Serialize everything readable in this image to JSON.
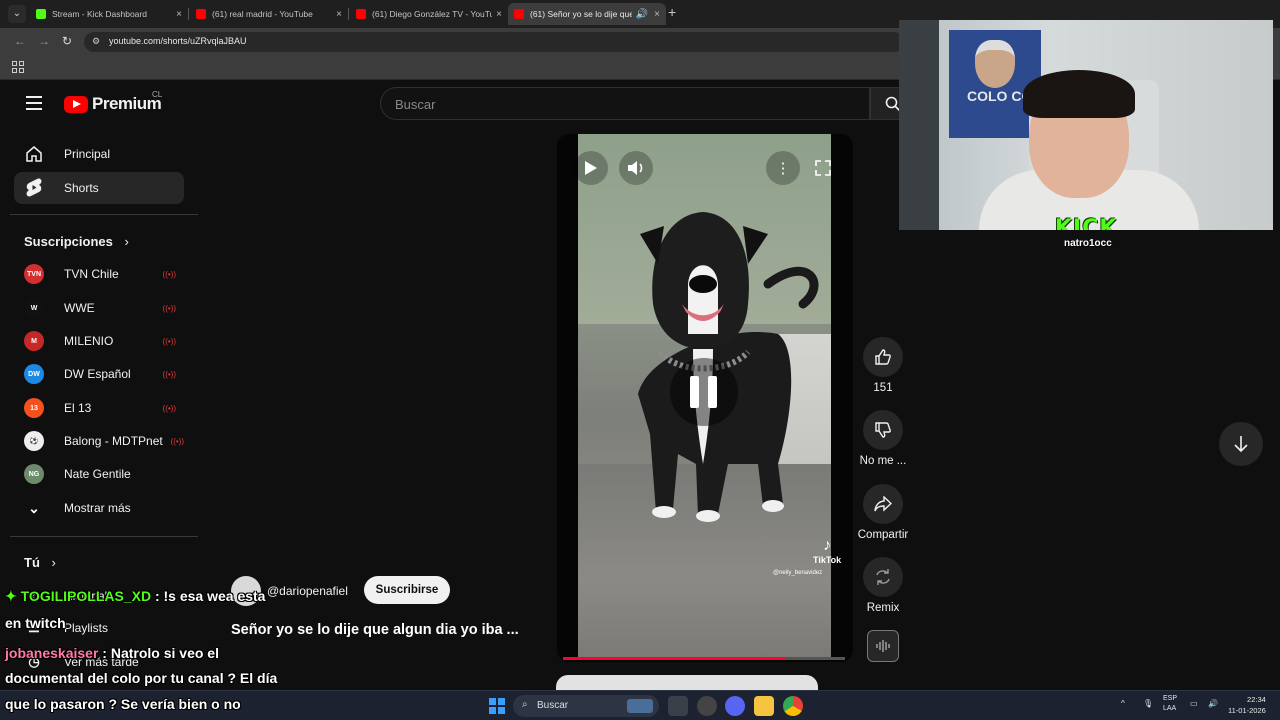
{
  "browser": {
    "tabs": [
      {
        "title": "Stream - Kick Dashboard",
        "favicon_color": "#53fc18",
        "active": false
      },
      {
        "title": "(61) real madrid - YouTube",
        "favicon_color": "#ff0000",
        "active": false
      },
      {
        "title": "(61) Diego González TV - YouTu",
        "favicon_color": "#ff0000",
        "active": false
      },
      {
        "title": "(61) Señor yo se lo dije que",
        "favicon_color": "#ff0000",
        "active": true
      }
    ],
    "url": "youtube.com/shorts/uZRvqlaJBAU"
  },
  "youtube": {
    "logo_text": "Premium",
    "country_code": "CL",
    "search_placeholder": "Buscar",
    "sidebar": {
      "main_items": [
        {
          "label": "Principal",
          "icon": "home-icon"
        },
        {
          "label": "Shorts",
          "icon": "shorts-icon"
        }
      ],
      "subscriptions_heading": "Suscripciones",
      "subscriptions": [
        {
          "name": "TVN Chile",
          "avatar_text": "TVN",
          "color": "#d32f2f",
          "live": true
        },
        {
          "name": "WWE",
          "avatar_text": "W",
          "color": "#111111",
          "live": true
        },
        {
          "name": "MILENIO",
          "avatar_text": "M",
          "color": "#c62828",
          "live": true
        },
        {
          "name": "DW Español",
          "avatar_text": "DW",
          "color": "#1e88e5",
          "live": true
        },
        {
          "name": "El 13",
          "avatar_text": "13",
          "color": "#f4511e",
          "live": true
        },
        {
          "name": "Balong - MDTPnet",
          "avatar_text": "⚽",
          "color": "#eeeeee",
          "live": true
        },
        {
          "name": "Nate Gentile",
          "avatar_text": "NG",
          "color": "#6d8a6a",
          "live": false
        }
      ],
      "show_more": "Mostrar más",
      "you_heading": "Tú",
      "you_items": [
        {
          "label": "Historial"
        },
        {
          "label": "Playlists"
        },
        {
          "label": "Ver más tarde"
        }
      ]
    },
    "short": {
      "channel": "@dariopenafiel",
      "subscribe_label": "Suscribirse",
      "title": "Señor yo se lo dije que algun dia yo iba ...",
      "watermark_brand": "TikTok",
      "watermark_handle": "@neily_benavidez",
      "progress": 0.79
    },
    "actions": {
      "like_count": "151",
      "dislike_label": "No me ...",
      "share_label": "Compartir",
      "remix_label": "Remix"
    }
  },
  "stream_overlay": {
    "webcam_poster_text": "COLO CO",
    "kick_logo": "KICK",
    "kick_user": "natro1occ",
    "chat": [
      {
        "user": "TOGILIPOLLAS_XD",
        "message": ": !s esa wea esta",
        "continuation": "en twitch"
      },
      {
        "user": "jobaneskaiser",
        "message": ": Natrolo si veo el",
        "continuation": "documental del colo por tu canal ? El día",
        "continuation2": "que lo pasaron ? Se vería bien o no"
      }
    ]
  },
  "taskbar": {
    "search_label": "Buscar",
    "language_top": "ESP",
    "language_bottom": "LAA",
    "time": "22:34",
    "date": "11-01-2026"
  }
}
